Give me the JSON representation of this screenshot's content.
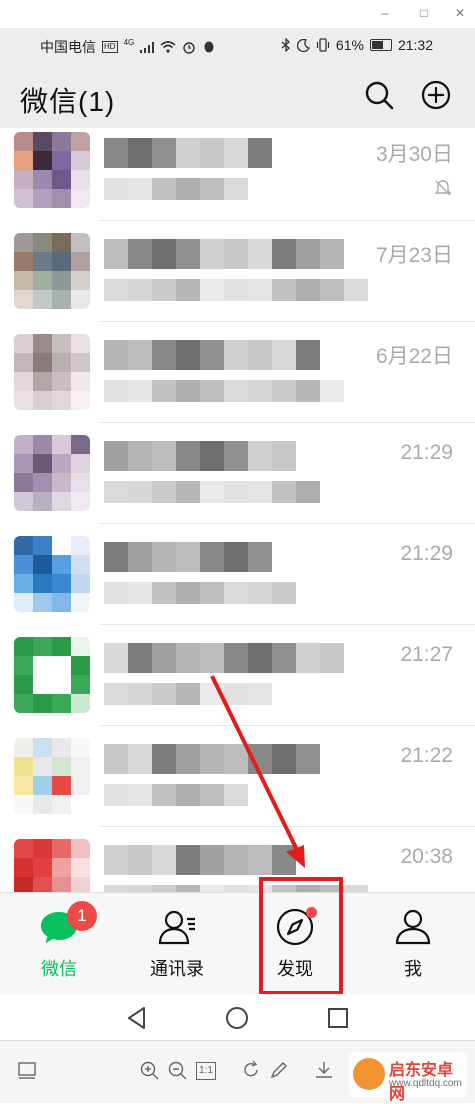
{
  "window": {
    "minimize": "–",
    "maximize": "□",
    "close": "✕"
  },
  "status_bar": {
    "carrier": "中国电信",
    "network_badge": "HD",
    "network_gen": "4G",
    "battery": "61%",
    "time": "21:32"
  },
  "header": {
    "title": "微信(1)",
    "search_icon": "search-icon",
    "add_icon": "plus-circle-icon"
  },
  "chats": [
    {
      "time": "3月30日",
      "muted": true
    },
    {
      "time": "7月23日",
      "muted": false
    },
    {
      "time": "6月22日",
      "muted": false
    },
    {
      "time": "21:29",
      "muted": false
    },
    {
      "time": "21:29",
      "muted": false
    },
    {
      "time": "21:27",
      "muted": false
    },
    {
      "time": "21:22",
      "muted": false
    },
    {
      "time": "20:38",
      "muted": false
    }
  ],
  "tabs": [
    {
      "label": "微信",
      "icon": "chat-bubble-icon",
      "badge": "1",
      "color": "#07c160"
    },
    {
      "label": "通讯录",
      "icon": "contacts-icon"
    },
    {
      "label": "发现",
      "icon": "compass-icon",
      "dot": true
    },
    {
      "label": "我",
      "icon": "person-icon"
    }
  ],
  "android_nav": {
    "back": "back-icon",
    "home": "home-icon",
    "recents": "recents-icon"
  },
  "viewer_toolbar": {
    "fit_label": "1:1"
  },
  "watermark": {
    "title": "启东安卓网",
    "url": "www.qdltdq.com"
  },
  "colors": {
    "accent_green": "#07c160",
    "highlight_red": "#e21c1c",
    "badge_red": "#f04a48"
  }
}
